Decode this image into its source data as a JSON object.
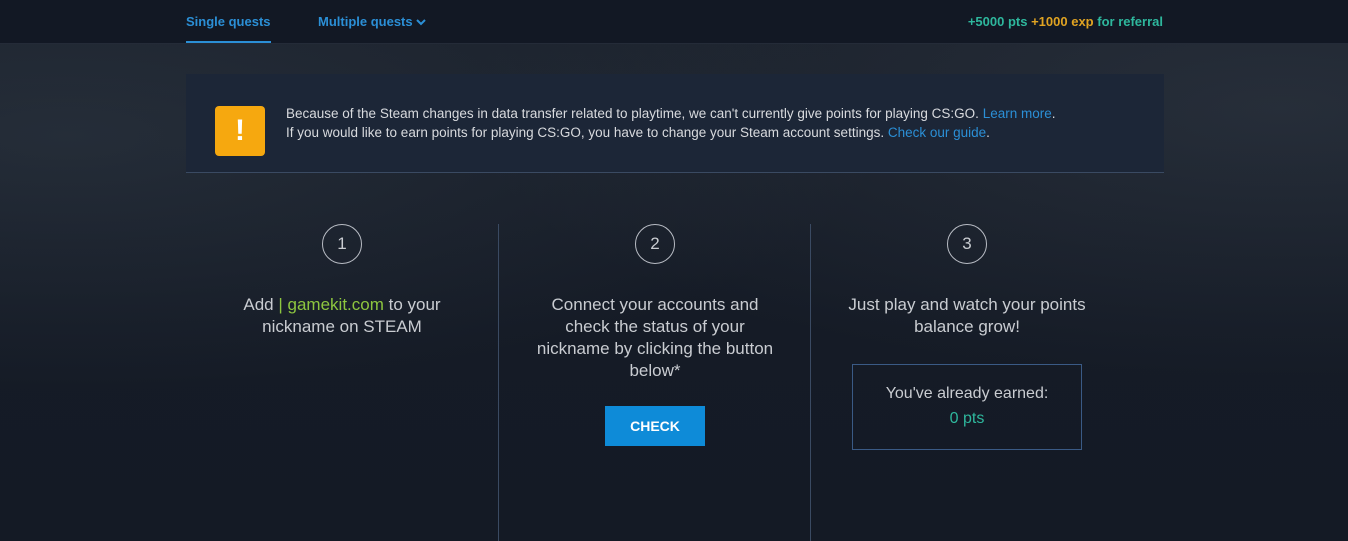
{
  "nav": {
    "single_quests": "Single quests",
    "multiple_quests": "Multiple quests",
    "referral": {
      "pts": "+5000 pts",
      "exp": "+1000 exp",
      "text": "for referral"
    }
  },
  "notice": {
    "icon": "exclamation-icon",
    "line1": "Because of the Steam changes in data transfer related to playtime, we can't currently give points for playing CS:GO.",
    "learn_more": "Learn more",
    "line2": "If you would like to earn points for playing CS:GO, you have to change your Steam account settings.",
    "check_guide": "Check our guide",
    "period": "."
  },
  "steps": [
    {
      "number": "1",
      "text_prefix": "Add ",
      "highlight": "| gamekit.com",
      "text_suffix": " to your nickname on STEAM"
    },
    {
      "number": "2",
      "text": "Connect your accounts and check the status of your nickname by clicking the button below*",
      "button": "CHECK"
    },
    {
      "number": "3",
      "text": "Just play and watch your points balance grow!",
      "earned_label": "You've already earned:",
      "earned_value": "0 pts"
    }
  ],
  "colors": {
    "accent_blue": "#2b8fd6",
    "teal": "#2eb79d",
    "orange": "#e0a322",
    "warning": "#f6a80f",
    "green": "#8dc63f"
  }
}
